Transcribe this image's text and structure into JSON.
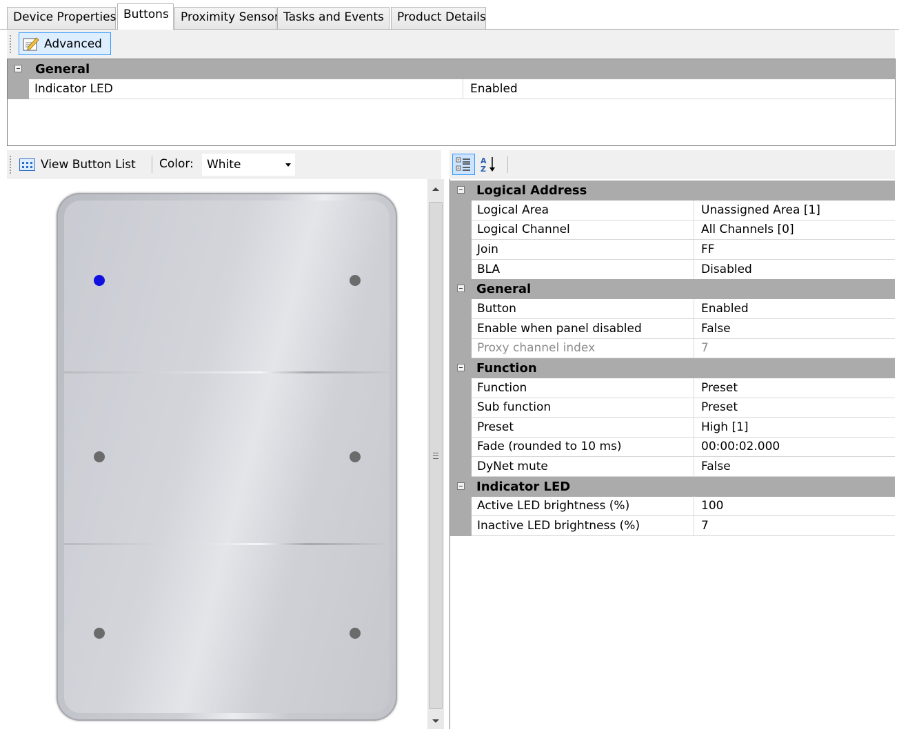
{
  "tabs": [
    "Device Properties",
    "Buttons",
    "Proximity Sensor",
    "Tasks and Events",
    "Product Details"
  ],
  "active_tab": "Buttons",
  "toolbar_top": {
    "advanced_label": "Advanced"
  },
  "general_grid": {
    "category": "General",
    "rows": [
      {
        "name": "Indicator LED",
        "value": "Enabled"
      }
    ]
  },
  "left_toolbar": {
    "view_button_list": "View Button List",
    "color_label": "Color:",
    "color_value": "White"
  },
  "panel": {
    "color": "White",
    "buttons": 6,
    "active_indicator": "top-left"
  },
  "property_grid": {
    "categories": [
      {
        "name": "Logical Address",
        "rows": [
          {
            "name": "Logical Area",
            "value": "Unassigned Area [1]"
          },
          {
            "name": "Logical Channel",
            "value": "All Channels [0]"
          },
          {
            "name": "Join",
            "value": "FF"
          },
          {
            "name": "BLA",
            "value": "Disabled"
          }
        ]
      },
      {
        "name": "General",
        "rows": [
          {
            "name": "Button",
            "value": "Enabled"
          },
          {
            "name": "Enable when panel disabled",
            "value": "False"
          },
          {
            "name": "Proxy channel index",
            "value": "7",
            "disabled": true
          }
        ]
      },
      {
        "name": "Function",
        "rows": [
          {
            "name": "Function",
            "value": "Preset"
          },
          {
            "name": "Sub function",
            "value": "Preset"
          },
          {
            "name": "Preset",
            "value": "High [1]"
          },
          {
            "name": "Fade (rounded to 10 ms)",
            "value": "00:00:02.000"
          },
          {
            "name": "DyNet mute",
            "value": "False"
          }
        ]
      },
      {
        "name": "Indicator LED",
        "rows": [
          {
            "name": "Active LED brightness (%)",
            "value": "100"
          },
          {
            "name": "Inactive LED brightness (%)",
            "value": "7"
          }
        ]
      }
    ]
  },
  "colors": {
    "grid_category": "#ababab",
    "selection": "#3399ff",
    "active_led": "#1010e0",
    "inactive_led": "#6b6b6b"
  }
}
